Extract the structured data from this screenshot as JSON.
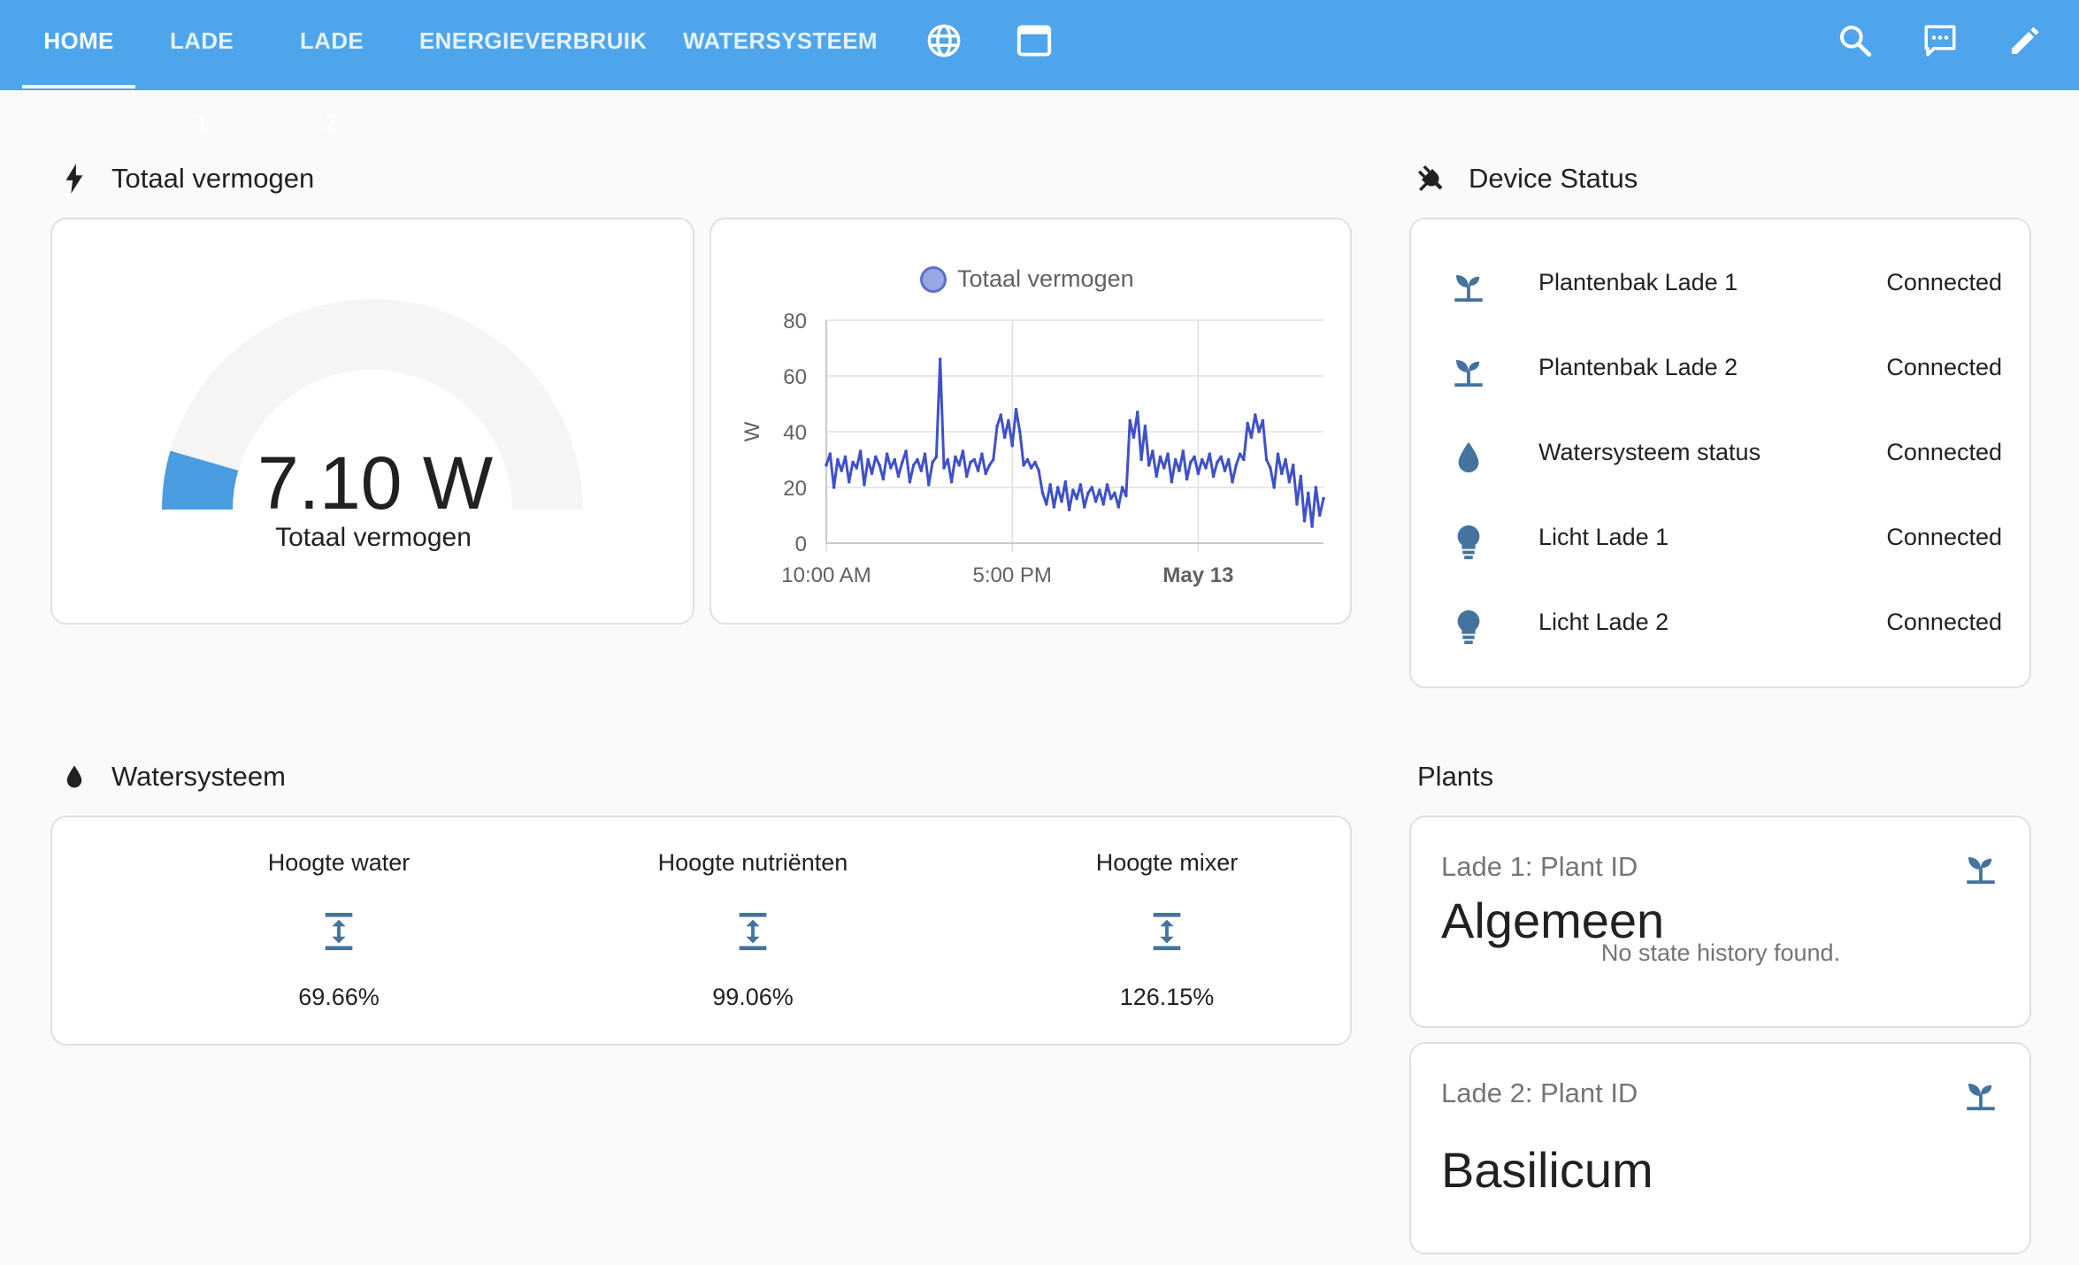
{
  "nav": {
    "tabs": [
      {
        "label": "HOME",
        "active": true
      },
      {
        "label": "LADE 1",
        "active": false
      },
      {
        "label": "LADE 2",
        "active": false
      },
      {
        "label": "ENERGIEVERBRUIK",
        "active": false
      },
      {
        "label": "WATERSYSTEEM",
        "active": false
      }
    ],
    "icon_tabs": [
      "globe-icon",
      "window-icon"
    ],
    "actions": [
      "search-icon",
      "chat-icon",
      "pencil-icon"
    ]
  },
  "colors": {
    "header": "#4ea5ec",
    "accent_blue": "#3f51c8",
    "gauge_fill": "#4a9ce0",
    "icon_slate": "#44739e"
  },
  "power_section": {
    "title": "Totaal vermogen",
    "icon": "flash-icon",
    "gauge": {
      "value": "7.10 W",
      "label": "Totaal vermogen",
      "level_fraction": 0.09
    },
    "chart": {
      "legend": "Totaal vermogen"
    }
  },
  "chart_data": {
    "type": "line",
    "title": "",
    "ylabel": "W",
    "ylim": [
      0,
      80
    ],
    "yticks": [
      "0",
      "20",
      "40",
      "60",
      "80"
    ],
    "xticks": [
      "10:00 AM",
      "5:00 PM",
      "May 13"
    ],
    "series": [
      {
        "name": "Totaal vermogen",
        "points": [
          [
            0,
            28
          ],
          [
            1,
            32
          ],
          [
            2,
            20
          ],
          [
            3,
            30
          ],
          [
            4,
            26
          ],
          [
            5,
            31
          ],
          [
            6,
            22
          ],
          [
            7,
            29
          ],
          [
            8,
            27
          ],
          [
            9,
            33
          ],
          [
            10,
            21
          ],
          [
            11,
            30
          ],
          [
            12,
            25
          ],
          [
            13,
            31
          ],
          [
            14,
            28
          ],
          [
            15,
            23
          ],
          [
            16,
            32
          ],
          [
            17,
            27
          ],
          [
            18,
            30
          ],
          [
            19,
            24
          ],
          [
            20,
            29
          ],
          [
            21,
            33
          ],
          [
            22,
            22
          ],
          [
            23,
            28
          ],
          [
            24,
            30
          ],
          [
            25,
            26
          ],
          [
            26,
            32
          ],
          [
            27,
            21
          ],
          [
            28,
            29
          ],
          [
            29,
            31
          ],
          [
            30,
            66
          ],
          [
            31,
            27
          ],
          [
            32,
            30
          ],
          [
            33,
            22
          ],
          [
            34,
            31
          ],
          [
            35,
            28
          ],
          [
            36,
            33
          ],
          [
            37,
            24
          ],
          [
            38,
            29
          ],
          [
            39,
            30
          ],
          [
            40,
            26
          ],
          [
            41,
            32
          ],
          [
            42,
            25
          ],
          [
            43,
            28
          ],
          [
            44,
            30
          ],
          [
            45,
            42
          ],
          [
            46,
            46
          ],
          [
            47,
            38
          ],
          [
            48,
            44
          ],
          [
            49,
            35
          ],
          [
            50,
            48
          ],
          [
            51,
            40
          ],
          [
            52,
            28
          ],
          [
            53,
            30
          ],
          [
            54,
            27
          ],
          [
            55,
            29
          ],
          [
            56,
            26
          ],
          [
            57,
            18
          ],
          [
            58,
            14
          ],
          [
            59,
            21
          ],
          [
            60,
            13
          ],
          [
            61,
            20
          ],
          [
            62,
            15
          ],
          [
            63,
            22
          ],
          [
            64,
            12
          ],
          [
            65,
            19
          ],
          [
            66,
            16
          ],
          [
            67,
            21
          ],
          [
            68,
            13
          ],
          [
            69,
            18
          ],
          [
            70,
            20
          ],
          [
            71,
            15
          ],
          [
            72,
            19
          ],
          [
            73,
            14
          ],
          [
            74,
            21
          ],
          [
            75,
            16
          ],
          [
            76,
            18
          ],
          [
            77,
            13
          ],
          [
            78,
            20
          ],
          [
            79,
            17
          ],
          [
            80,
            44
          ],
          [
            81,
            38
          ],
          [
            82,
            47
          ],
          [
            83,
            30
          ],
          [
            84,
            42
          ],
          [
            85,
            28
          ],
          [
            86,
            33
          ],
          [
            87,
            24
          ],
          [
            88,
            31
          ],
          [
            89,
            27
          ],
          [
            90,
            32
          ],
          [
            91,
            22
          ],
          [
            92,
            30
          ],
          [
            93,
            26
          ],
          [
            94,
            33
          ],
          [
            95,
            23
          ],
          [
            96,
            29
          ],
          [
            97,
            31
          ],
          [
            98,
            25
          ],
          [
            99,
            30
          ],
          [
            100,
            27
          ],
          [
            101,
            32
          ],
          [
            102,
            24
          ],
          [
            103,
            29
          ],
          [
            104,
            31
          ],
          [
            105,
            26
          ],
          [
            106,
            30
          ],
          [
            107,
            22
          ],
          [
            108,
            28
          ],
          [
            109,
            32
          ],
          [
            110,
            30
          ],
          [
            111,
            43
          ],
          [
            112,
            38
          ],
          [
            113,
            46
          ],
          [
            114,
            40
          ],
          [
            115,
            44
          ],
          [
            116,
            30
          ],
          [
            117,
            27
          ],
          [
            118,
            20
          ],
          [
            119,
            32
          ],
          [
            120,
            25
          ],
          [
            121,
            30
          ],
          [
            122,
            22
          ],
          [
            123,
            28
          ],
          [
            124,
            14
          ],
          [
            125,
            24
          ],
          [
            126,
            8
          ],
          [
            127,
            18
          ],
          [
            128,
            6
          ],
          [
            129,
            20
          ],
          [
            130,
            10
          ],
          [
            131,
            16
          ]
        ]
      }
    ]
  },
  "device_section": {
    "title": "Device Status",
    "icon": "plug-icon",
    "devices": [
      {
        "name": "Plantenbak Lade 1",
        "state": "Connected",
        "icon": "sprout-icon"
      },
      {
        "name": "Plantenbak Lade 2",
        "state": "Connected",
        "icon": "sprout-icon"
      },
      {
        "name": "Watersysteem status",
        "state": "Connected",
        "icon": "water-drop-icon"
      },
      {
        "name": "Licht Lade 1",
        "state": "Connected",
        "icon": "lightbulb-icon"
      },
      {
        "name": "Licht Lade 2",
        "state": "Connected",
        "icon": "lightbulb-icon"
      }
    ]
  },
  "water_section": {
    "title": "Watersysteem",
    "icon": "water-drop-icon",
    "items": [
      {
        "label": "Hoogte water",
        "value": "69.66%",
        "icon": "height-icon"
      },
      {
        "label": "Hoogte nutriënten",
        "value": "99.06%",
        "icon": "height-icon"
      },
      {
        "label": "Hoogte mixer",
        "value": "126.15%",
        "icon": "height-icon"
      }
    ]
  },
  "plants_section": {
    "title": "Plants",
    "cards": [
      {
        "title": "Lade 1: Plant ID",
        "name": "Algemeen",
        "note": "No state history found.",
        "icon": "sprout-icon"
      },
      {
        "title": "Lade 2: Plant ID",
        "name": "Basilicum",
        "icon": "sprout-icon"
      }
    ]
  }
}
